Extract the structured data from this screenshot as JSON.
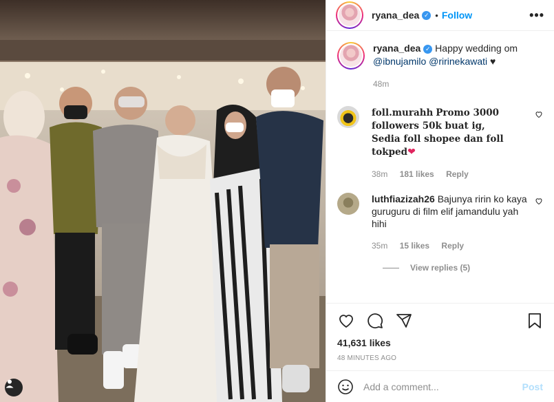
{
  "post": {
    "username": "ryana_dea",
    "follow_label": "Follow",
    "dot": "•",
    "more": "•••"
  },
  "caption": {
    "username": "ryana_dea",
    "text_before": "Happy wedding om",
    "mention1": "@ibnujamilo",
    "mention2": "@ririnekawati",
    "heart": "♥",
    "time": "48m"
  },
  "comments": [
    {
      "username": "foll.murahh",
      "text": "Promo 3000 followers 50k buat ig, Sedia foll shopee dan foll tokped",
      "emoji": "❤",
      "time": "38m",
      "likes": "181 likes",
      "reply": "Reply"
    },
    {
      "username": "luthfiazizah26",
      "text": "Bajunya ririn ko kaya guruguru di film elif jamandulu yah hihi",
      "time": "35m",
      "likes": "15 likes",
      "reply": "Reply",
      "view_replies": "View replies (5)"
    }
  ],
  "footer": {
    "likes": "41,631 likes",
    "ago": "48 MINUTES AGO",
    "placeholder": "Add a comment...",
    "post_label": "Post"
  },
  "colors": {
    "link": "#0095f6",
    "mention": "#00376b",
    "muted": "#8e8e8e",
    "emoji_heart": "#e0245e"
  },
  "icons": [
    "verified-icon",
    "more-icon",
    "heart-icon",
    "comment-icon",
    "share-icon",
    "bookmark-icon",
    "emoji-icon",
    "tag-user-icon"
  ]
}
